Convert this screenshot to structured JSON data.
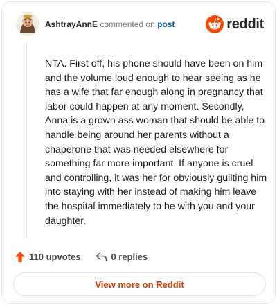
{
  "header": {
    "username": "AshtrayAnnE",
    "verb": "commented on",
    "link_text": "post",
    "brand": "reddit"
  },
  "comment": {
    "text": "NTA. First off, his phone should have been on him and the volume loud enough to hear seeing as he has a wife that far enough along in pregnancy that labor could happen at any moment. Secondly, Anna is a grown ass woman that should be able to handle being around her parents without a chaperone that was needed elsewhere for something far more important. If anyone is cruel and controlling, it was her for obviously guilting him into staying with her instead of making him leave the hospital immediately to be with you and your daughter."
  },
  "actions": {
    "upvotes": "110 upvotes",
    "replies": "0 replies"
  },
  "view_more_label": "View more on Reddit",
  "colors": {
    "brand": "#ff4500",
    "link": "#0a5fb4",
    "cta": "#d93a00"
  },
  "icons": [
    "avatar",
    "reddit-logo-icon",
    "upvote-arrow-icon",
    "reply-arrow-icon"
  ]
}
